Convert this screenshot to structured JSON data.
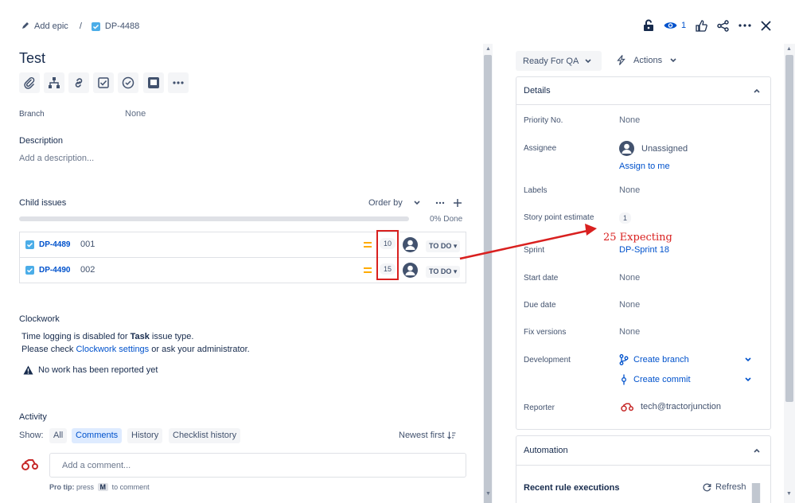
{
  "breadcrumb": {
    "add_epic": "Add epic",
    "separator": "/",
    "issue_key": "DP-4488"
  },
  "header": {
    "watch_count": "1"
  },
  "issue": {
    "title": "Test"
  },
  "branch": {
    "label": "Branch",
    "value": "None"
  },
  "description": {
    "label": "Description",
    "placeholder": "Add a description..."
  },
  "child_issues": {
    "label": "Child issues",
    "order_by": "Order by",
    "progress_text": "0% Done",
    "progress_fraction": 0,
    "items": [
      {
        "key": "DP-4489",
        "summary": "001",
        "points": "10",
        "status": "TO DO"
      },
      {
        "key": "DP-4490",
        "summary": "002",
        "points": "15",
        "status": "TO DO"
      }
    ]
  },
  "clockwork": {
    "label": "Clockwork",
    "line1_prefix": "Time logging is disabled for ",
    "line1_bold": "Task",
    "line1_suffix": " issue type.",
    "line2_prefix": "Please check ",
    "line2_link": "Clockwork settings",
    "line2_suffix": " or ask your administrator.",
    "warning": "No work has been reported yet"
  },
  "activity": {
    "label": "Activity",
    "show": "Show:",
    "tabs": [
      "All",
      "Comments",
      "History",
      "Checklist history"
    ],
    "sort": "Newest first",
    "comment_placeholder": "Add a comment...",
    "tip_prefix": "Pro tip:",
    "tip_press": "press",
    "tip_key": "M",
    "tip_suffix": "to comment"
  },
  "status_button": "Ready For QA",
  "actions_button": "Actions",
  "details": {
    "title": "Details",
    "priority_label": "Priority No.",
    "priority_value": "None",
    "assignee_label": "Assignee",
    "assignee_value": "Unassigned",
    "assign_to_me": "Assign to me",
    "labels_label": "Labels",
    "labels_value": "None",
    "story_label": "Story point estimate",
    "story_value": "1",
    "sprint_label": "Sprint",
    "sprint_value": "DP-Sprint 18",
    "start_label": "Start date",
    "start_value": "None",
    "due_label": "Due date",
    "due_value": "None",
    "fix_label": "Fix versions",
    "fix_value": "None",
    "dev_label": "Development",
    "create_branch": "Create branch",
    "create_commit": "Create commit",
    "reporter_label": "Reporter",
    "reporter_value": "tech@tractorjunction"
  },
  "annotation": {
    "text": "25 Expecting",
    "color": "#d9201f"
  },
  "automation": {
    "title": "Automation",
    "recent": "Recent rule executions",
    "refresh": "Refresh"
  },
  "colors": {
    "link": "#0052cc",
    "text": "#172b4d",
    "muted": "#5e6c84",
    "task": "#4bade8",
    "medium": "#ffab00"
  }
}
